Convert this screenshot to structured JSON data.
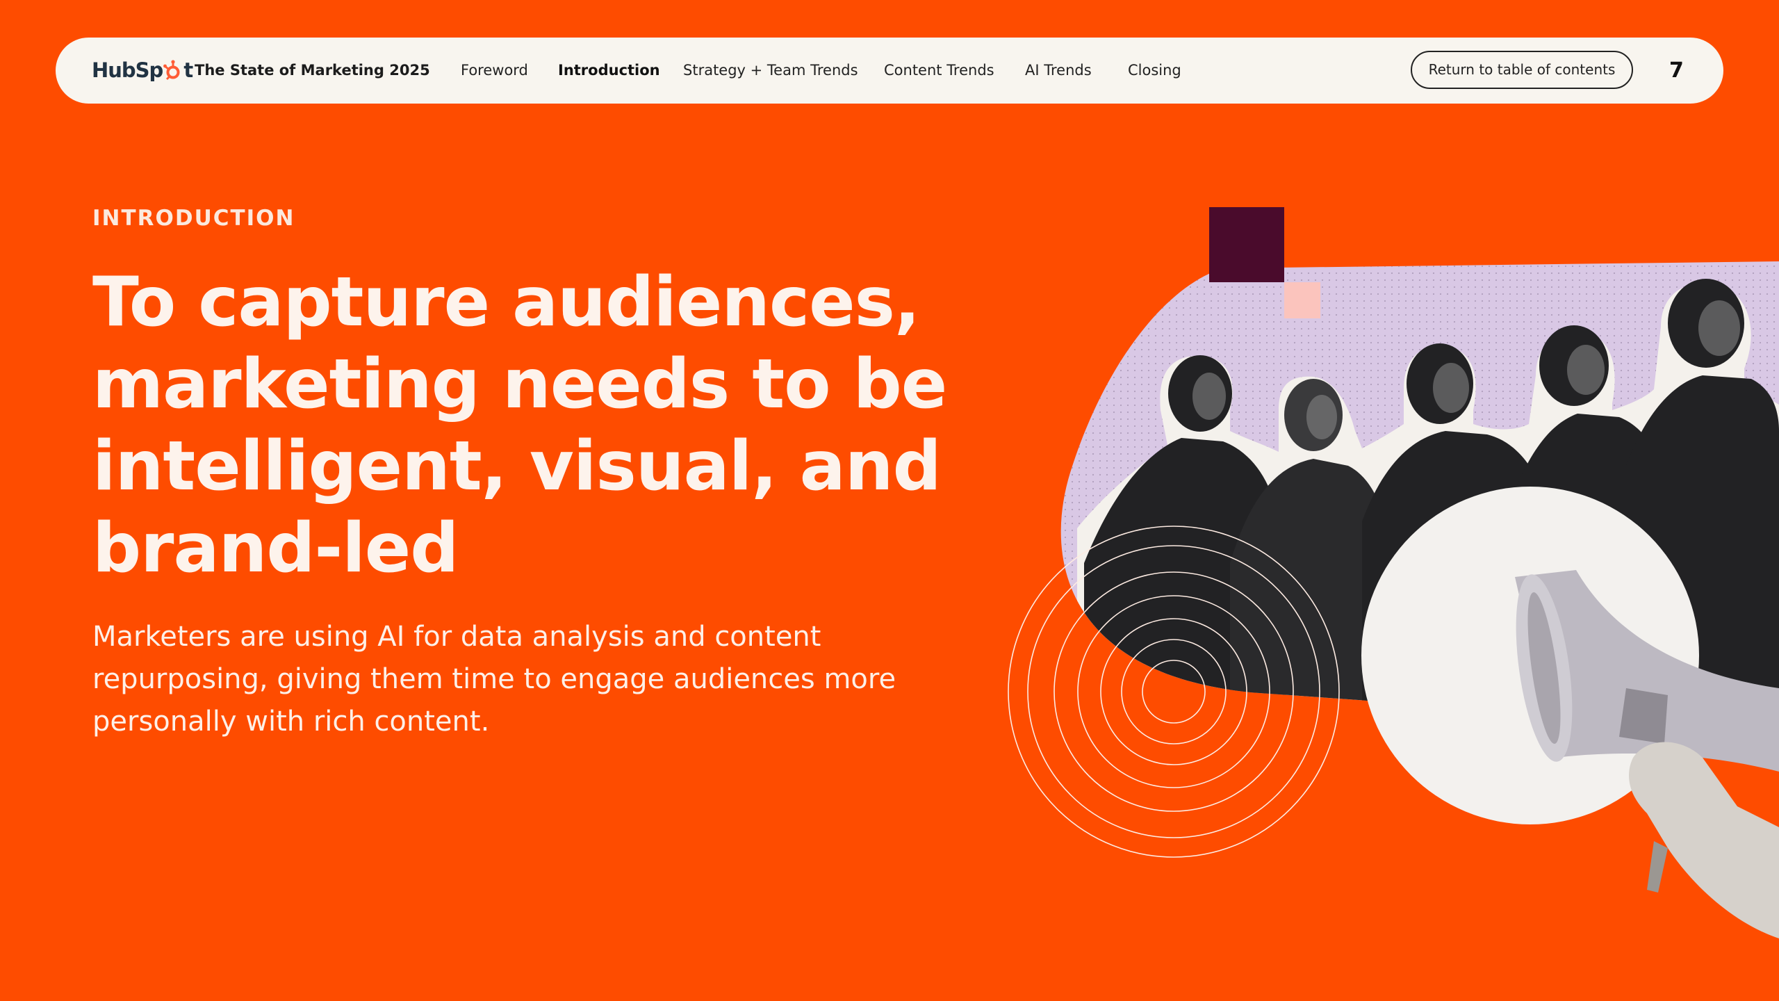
{
  "colors": {
    "background": "#fe4c00",
    "nav_background": "#f8f5ef",
    "headline_text": "#fdf3ec",
    "lavender_panel": "#d9c8e5",
    "plum_square": "#4a0b2c",
    "pink_square": "#fbc4bd"
  },
  "nav": {
    "logo_text": "HubSpot",
    "report_title": "The State of Marketing 2025",
    "links": [
      {
        "label": "Foreword",
        "active": false
      },
      {
        "label": "Introduction",
        "active": true
      },
      {
        "label": "Strategy + Team Trends",
        "active": false
      },
      {
        "label": "Content Trends",
        "active": false
      },
      {
        "label": "AI Trends",
        "active": false
      },
      {
        "label": "Closing",
        "active": false
      }
    ],
    "toc_button_label": "Return to table of contents",
    "page_number": "7"
  },
  "main": {
    "eyebrow": "INTRODUCTION",
    "headline": "To capture audiences, marketing needs to be intelligent, visual, and brand-led",
    "body": "Marketers are using AI for data analysis and content repurposing, giving them time to engage audiences more personally with rich content."
  },
  "illustration": {
    "people_count": 5,
    "icons": [
      "megaphone-icon",
      "concentric-rings-graphic"
    ]
  }
}
